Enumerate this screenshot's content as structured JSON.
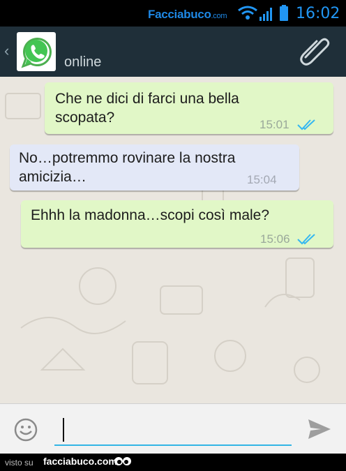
{
  "status_bar": {
    "brand_main": "Facciabuco",
    "brand_suffix": ".com",
    "time": "16:02"
  },
  "header": {
    "back_glyph": "‹",
    "contact_icon": "whatsapp-logo",
    "status": "online",
    "attach_icon": "paperclip-icon"
  },
  "messages": [
    {
      "direction": "outgoing",
      "text_line1": "Che ne dici di farci una bella",
      "text_line2": "scopata?",
      "time": "15:01",
      "ticks": "double-check-blue"
    },
    {
      "direction": "incoming",
      "text_line1": "No…potremmo rovinare la nostra",
      "text_line2": "amicizia…",
      "time": "15:04"
    },
    {
      "direction": "outgoing",
      "text_line1": "Ehhh la madonna…scopi così male?",
      "time": "15:06",
      "ticks": "double-check-blue"
    }
  ],
  "input_bar": {
    "emoji_icon": "smiley-icon",
    "value": "",
    "send_icon": "send-icon"
  },
  "footer": {
    "visto_su": "visto su",
    "site": "facciabuco.com"
  },
  "colors": {
    "header_bg": "#1f2f39",
    "outgoing_bubble": "#e1f7c7",
    "incoming_bubble": "#e3e8f7",
    "tick_blue": "#34b7f1",
    "accent": "#33b5e5"
  }
}
